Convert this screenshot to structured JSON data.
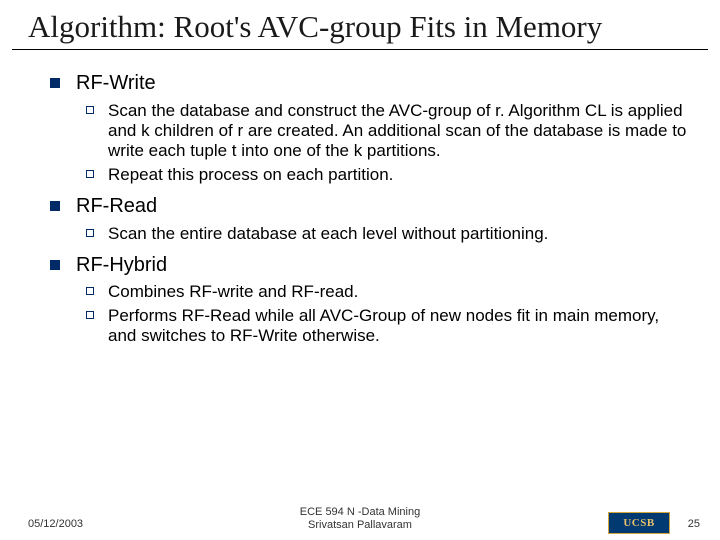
{
  "title": "Algorithm: Root's AVC-group Fits in Memory",
  "sections": {
    "s1": {
      "heading": "RF-Write",
      "b1": "Scan the database and construct the AVC-group of r. Algorithm CL is applied and k children of r are created.  An additional scan of the database is made to write each tuple t into one of the k partitions.",
      "b2": "Repeat this process on each partition."
    },
    "s2": {
      "heading": "RF-Read",
      "b1": "Scan the entire database at each level without partitioning."
    },
    "s3": {
      "heading": "RF-Hybrid",
      "b1": "Combines RF-write and RF-read.",
      "b2": "Performs RF-Read while all AVC-Group of new nodes fit in main memory, and switches to RF-Write otherwise."
    }
  },
  "footer": {
    "date": "05/12/2003",
    "center1": "ECE 594 N -Data Mining",
    "center2": "Srivatsan Pallavaram",
    "page": "25",
    "logo": "UCSB"
  }
}
